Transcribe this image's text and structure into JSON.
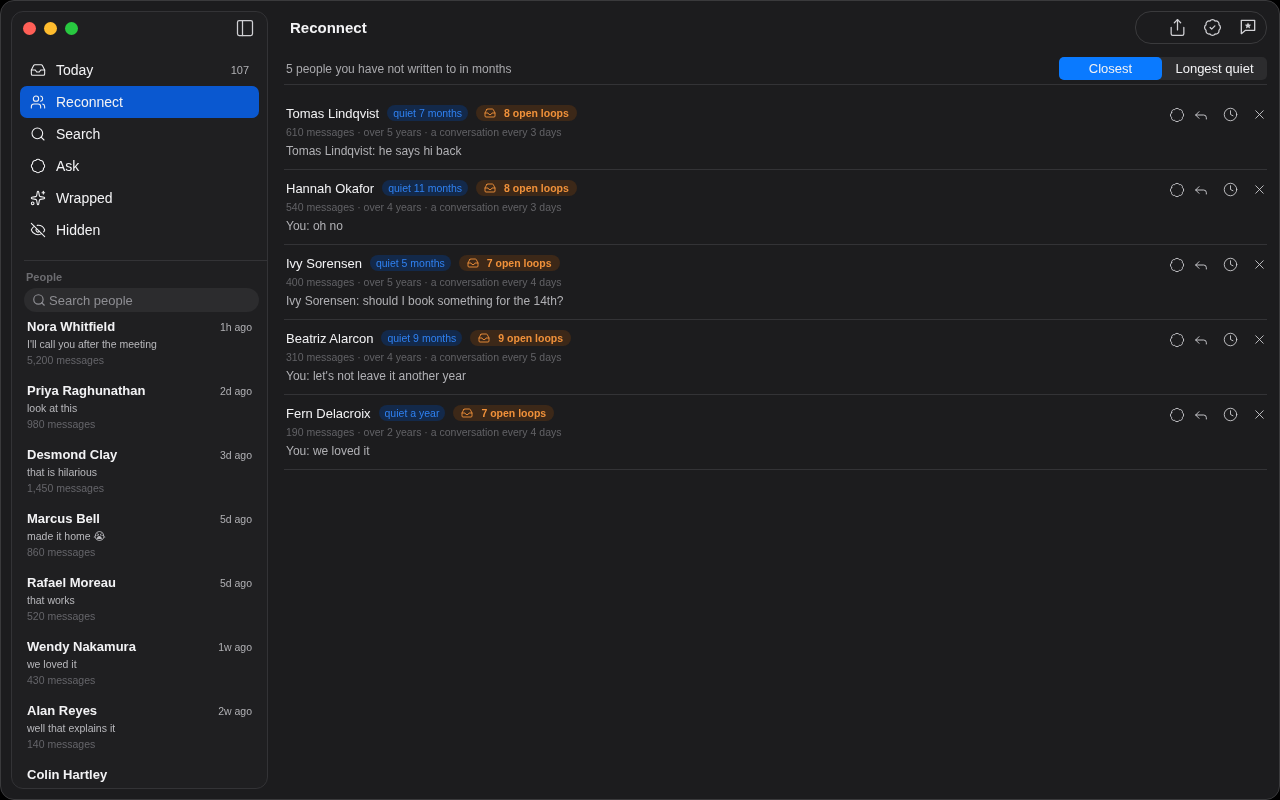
{
  "sidebar": {
    "nav": [
      {
        "kind": "today",
        "label": "Today",
        "count": "107",
        "selected": false
      },
      {
        "kind": "reconnect",
        "label": "Reconnect",
        "selected": true
      },
      {
        "kind": "search",
        "label": "Search",
        "selected": false
      },
      {
        "kind": "ask",
        "label": "Ask",
        "selected": false
      },
      {
        "kind": "wrapped",
        "label": "Wrapped",
        "selected": false
      },
      {
        "kind": "hidden",
        "label": "Hidden",
        "selected": false
      }
    ],
    "people_heading": "People",
    "search": {
      "placeholder": "Search people"
    },
    "people": [
      {
        "name": "Nora Whitfield",
        "time": "1h ago",
        "preview": "I'll call you after the meeting",
        "messages": "5,200 messages"
      },
      {
        "name": "Priya Raghunathan",
        "time": "2d ago",
        "preview": "look at this",
        "messages": "980 messages"
      },
      {
        "name": "Desmond Clay",
        "time": "3d ago",
        "preview": "that is hilarious",
        "messages": "1,450 messages"
      },
      {
        "name": "Marcus Bell",
        "time": "5d ago",
        "preview": "made it home 😭",
        "messages": "860 messages"
      },
      {
        "name": "Rafael Moreau",
        "time": "5d ago",
        "preview": "that works",
        "messages": "520 messages"
      },
      {
        "name": "Wendy Nakamura",
        "time": "1w ago",
        "preview": "we loved it",
        "messages": "430 messages"
      },
      {
        "name": "Alan Reyes",
        "time": "2w ago",
        "preview": "well that explains it",
        "messages": "140 messages"
      },
      {
        "name": "Colin Hartley"
      }
    ]
  },
  "main": {
    "title": "Reconnect",
    "summary": "5 people you have not written to in months",
    "sort_tabs": [
      {
        "label": "Closest",
        "selected": true
      },
      {
        "label": "Longest quiet",
        "selected": false
      }
    ],
    "contacts": [
      {
        "name": "Tomas Lindqvist",
        "quiet": "quiet 7 months",
        "loops": "8 open loops",
        "stats": "610 messages · over 5 years · a conversation every 3 days",
        "last_message": "Tomas Lindqvist: he says hi back"
      },
      {
        "name": "Hannah Okafor",
        "quiet": "quiet 11 months",
        "loops": "8 open loops",
        "stats": "540 messages · over 4 years · a conversation every 3 days",
        "last_message": "You: oh no"
      },
      {
        "name": "Ivy Sorensen",
        "quiet": "quiet 5 months",
        "loops": "7 open loops",
        "stats": "400 messages · over 5 years · a conversation every 4 days",
        "last_message": "Ivy Sorensen: should I book something for the 14th?"
      },
      {
        "name": "Beatriz Alarcon",
        "quiet": "quiet 9 months",
        "loops": "9 open loops",
        "stats": "310 messages · over 4 years · a conversation every 5 days",
        "last_message": "You: let's not leave it another year"
      },
      {
        "name": "Fern Delacroix",
        "quiet": "quiet a year",
        "loops": "7 open loops",
        "stats": "190 messages · over 2 years · a conversation every 4 days",
        "last_message": "You: we loved it"
      }
    ]
  }
}
